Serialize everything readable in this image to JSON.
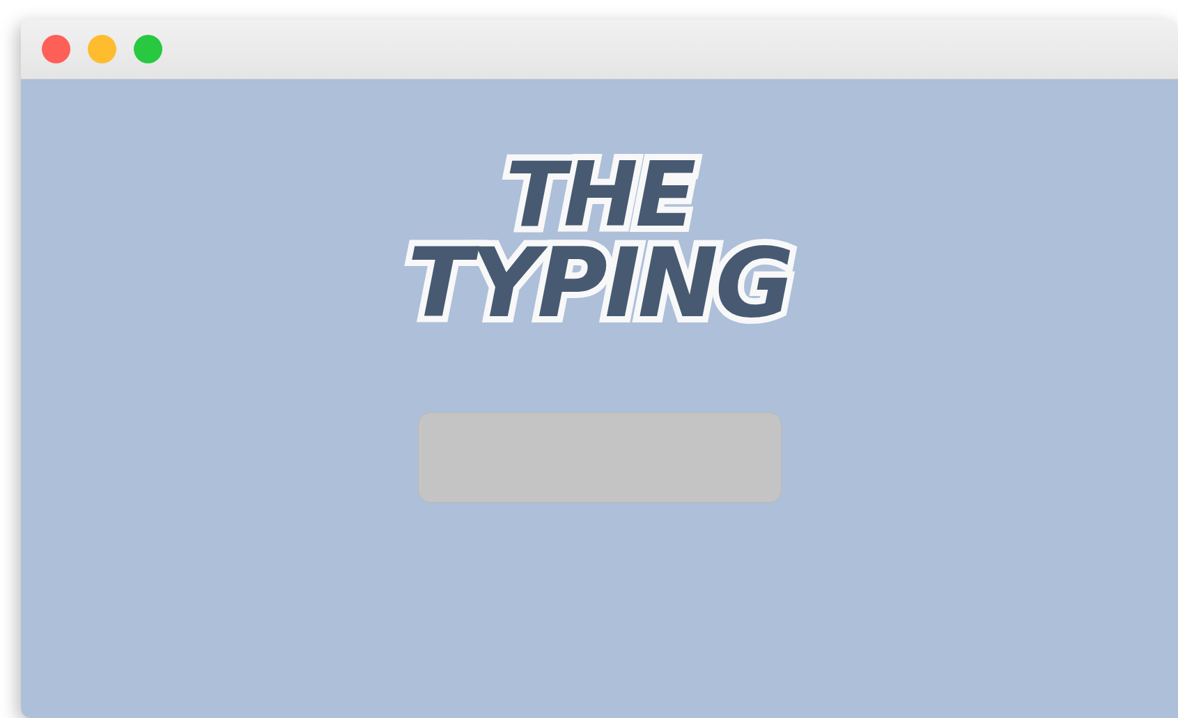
{
  "window": {
    "controls": [
      {
        "kind": "close"
      },
      {
        "kind": "minimize"
      },
      {
        "kind": "zoom"
      }
    ]
  },
  "logo": {
    "lines": [
      "THE",
      "TYPING"
    ]
  }
}
